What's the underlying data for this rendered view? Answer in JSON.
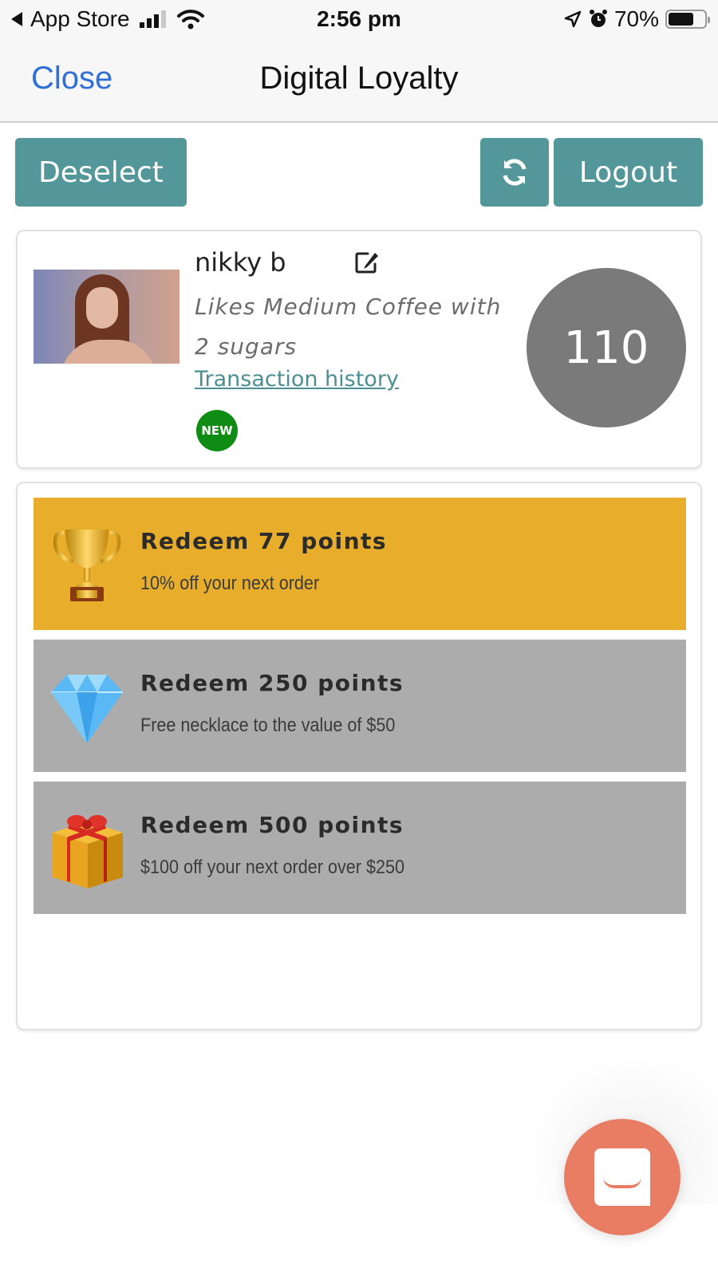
{
  "status_bar": {
    "back_app": "App Store",
    "time": "2:56 pm",
    "battery": "70%",
    "battery_level": 0.7,
    "icons": [
      "back-arrow-icon",
      "signal-icon",
      "wifi-icon",
      "location-icon",
      "alarm-icon",
      "battery-icon"
    ]
  },
  "nav": {
    "close_label": "Close",
    "title": "Digital Loyalty"
  },
  "toolbar": {
    "deselect_label": "Deselect",
    "refresh_icon": "refresh-icon",
    "logout_label": "Logout",
    "button_color": "#54979a"
  },
  "profile": {
    "name": "nikky b",
    "note": "Likes Medium Coffee with 2 sugars",
    "transaction_link": "Transaction history",
    "badge": "NEW",
    "badge_color": "#0f8c14",
    "points": "110",
    "points_color": "#7a7a7a"
  },
  "rewards": [
    {
      "icon": "trophy-icon",
      "title": "Redeem 77 points",
      "description": "10% off your next order",
      "available": true,
      "color": "#e8ad2a"
    },
    {
      "icon": "diamond-icon",
      "title": "Redeem 250 points",
      "description": "Free necklace to the value of $50",
      "available": false,
      "color": "#acacac"
    },
    {
      "icon": "gift-icon",
      "title": "Redeem 500 points",
      "description": "$100 off your next order over $250",
      "available": false,
      "color": "#acacac"
    }
  ],
  "chat": {
    "icon": "chat-icon",
    "color": "#e97d63"
  }
}
